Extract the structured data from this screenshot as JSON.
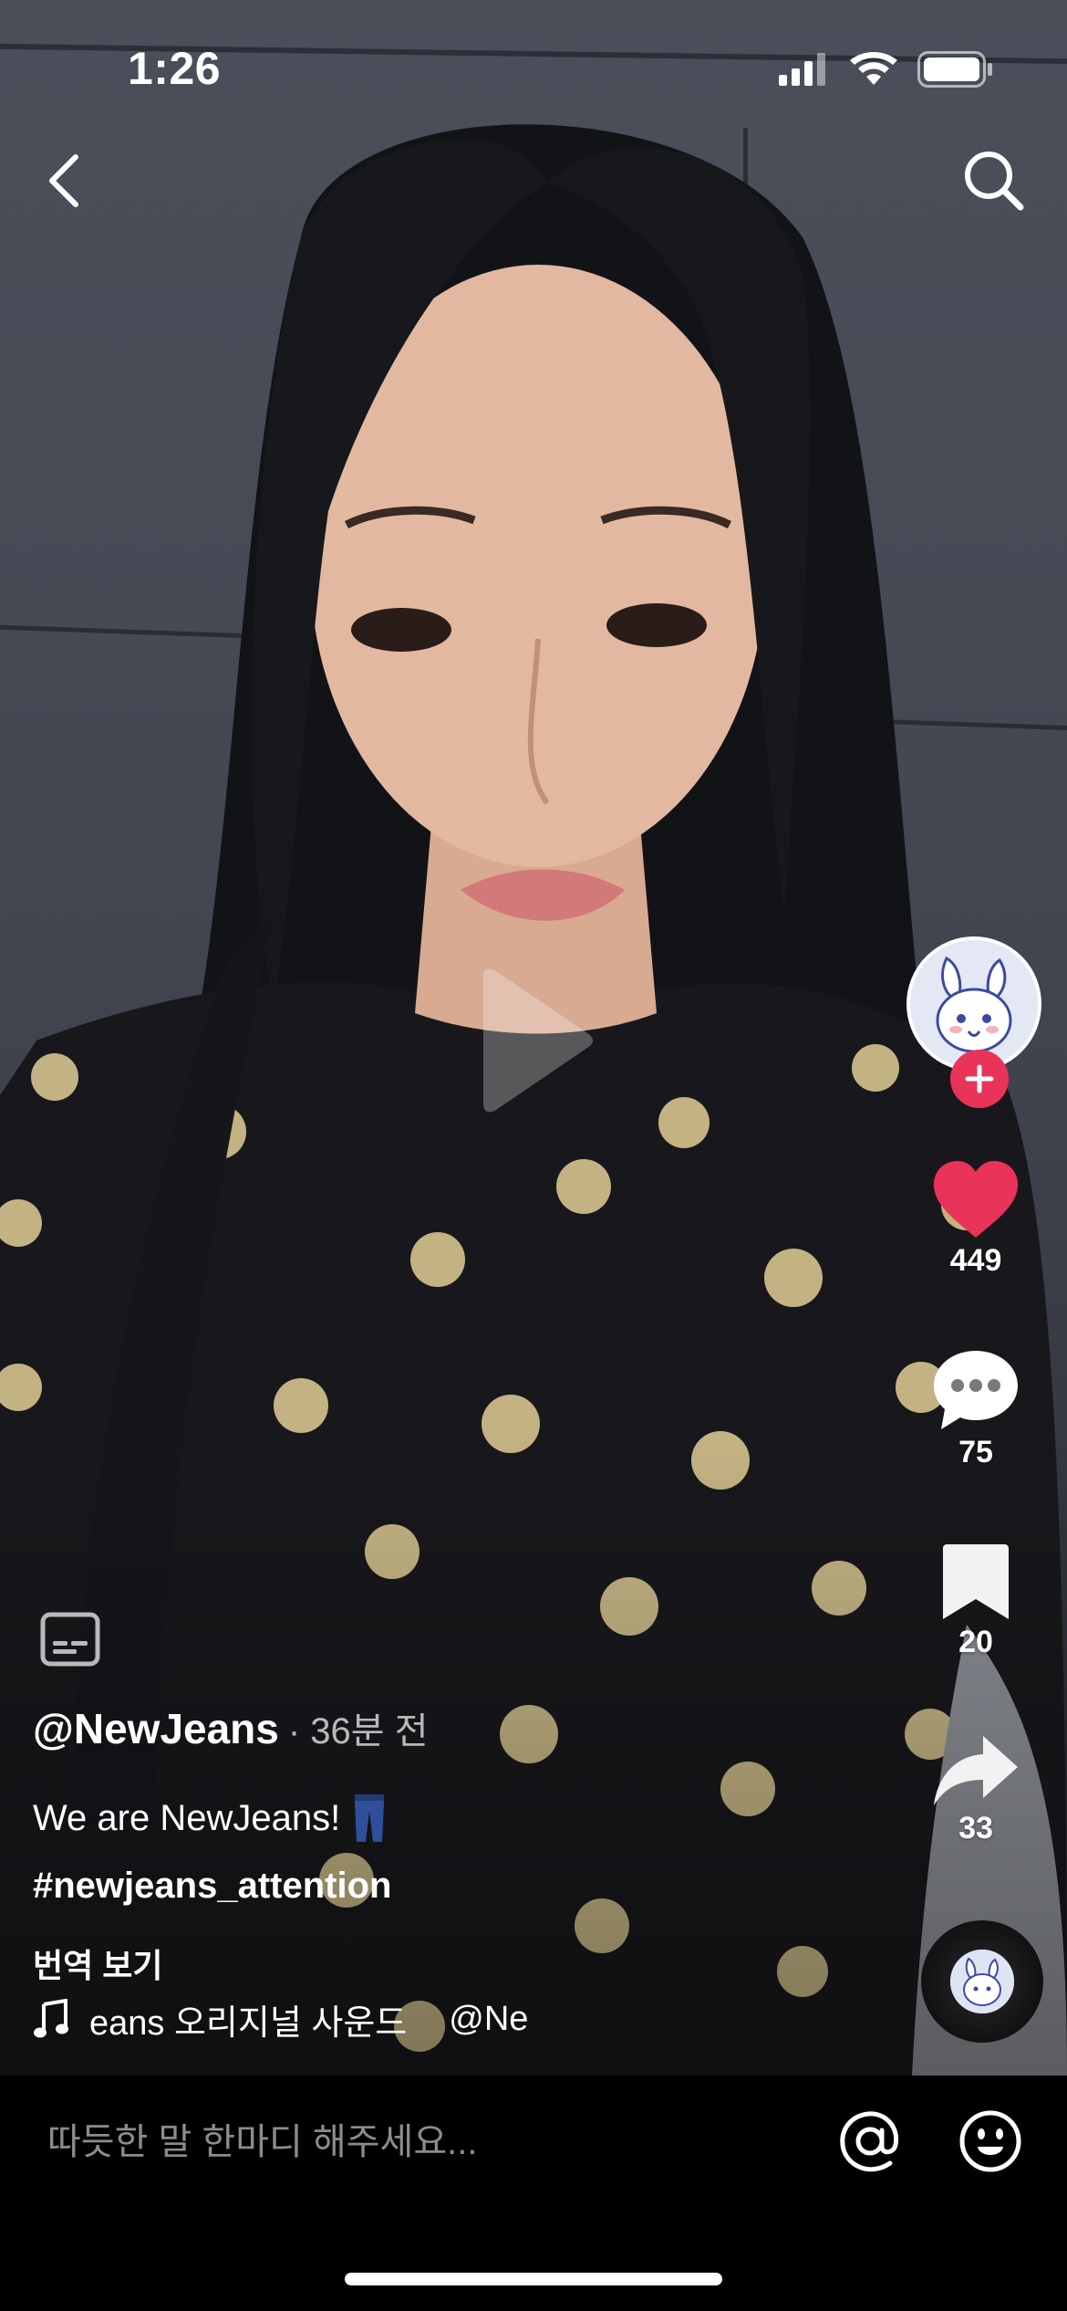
{
  "status_bar": {
    "time": "1:26",
    "icons": [
      "cellular-signal-icon",
      "wifi-icon",
      "battery-icon"
    ]
  },
  "top_nav": {
    "back_icon": "chevron-left-icon",
    "search_icon": "search-icon"
  },
  "video": {
    "state_icon": "play-icon"
  },
  "rail": {
    "avatar_icon": "bunny-avatar-icon",
    "follow_icon": "plus-icon",
    "like_count": "449",
    "comment_count": "75",
    "bookmark_count": "20",
    "share_count": "33",
    "like_color": "#ea3358"
  },
  "post": {
    "author": "@NewJeans",
    "time_ago": "· 36분 전",
    "caption": "We are NewJeans!",
    "caption_icon": "jeans-icon",
    "hashtag": "#newjeans_attention",
    "translate_label": "번역 보기",
    "music_label": "eans 오리지널 사운드",
    "music_author": "@Ne"
  },
  "comment_bar": {
    "placeholder": "따듯한 말 한마디 해주세요...",
    "at_icon": "at-sign-icon",
    "emoji_icon": "emoji-icon"
  },
  "colors": {
    "accent": "#ea3358",
    "background": "#000000"
  }
}
